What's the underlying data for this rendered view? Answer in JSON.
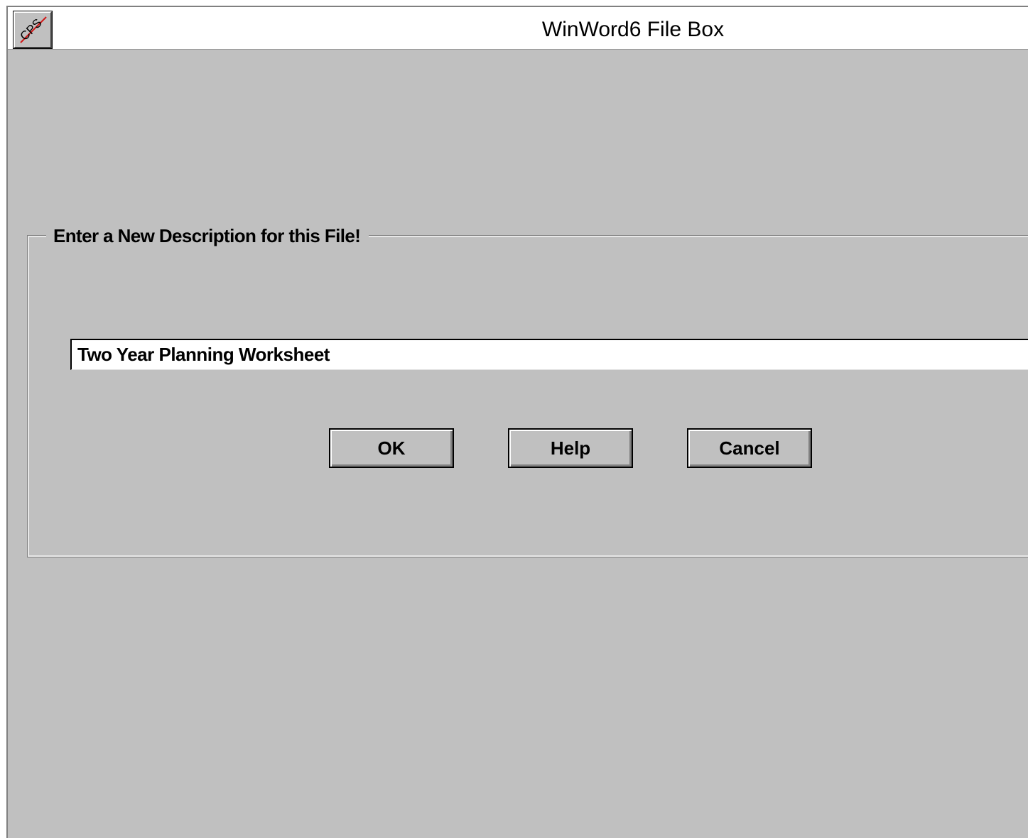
{
  "window": {
    "title": "WinWord6 File Box",
    "sysmenu_icon": "cps-logo-icon",
    "sysmenu_text": "CPS"
  },
  "group": {
    "label": "Enter a New Description for this File!"
  },
  "description_input": {
    "value": "Two Year Planning Worksheet"
  },
  "buttons": {
    "ok": "OK",
    "help": "Help",
    "cancel": "Cancel"
  },
  "colors": {
    "face": "#c0c0c0",
    "titlebar": "#ffffff",
    "logo_stroke": "#d01818"
  }
}
